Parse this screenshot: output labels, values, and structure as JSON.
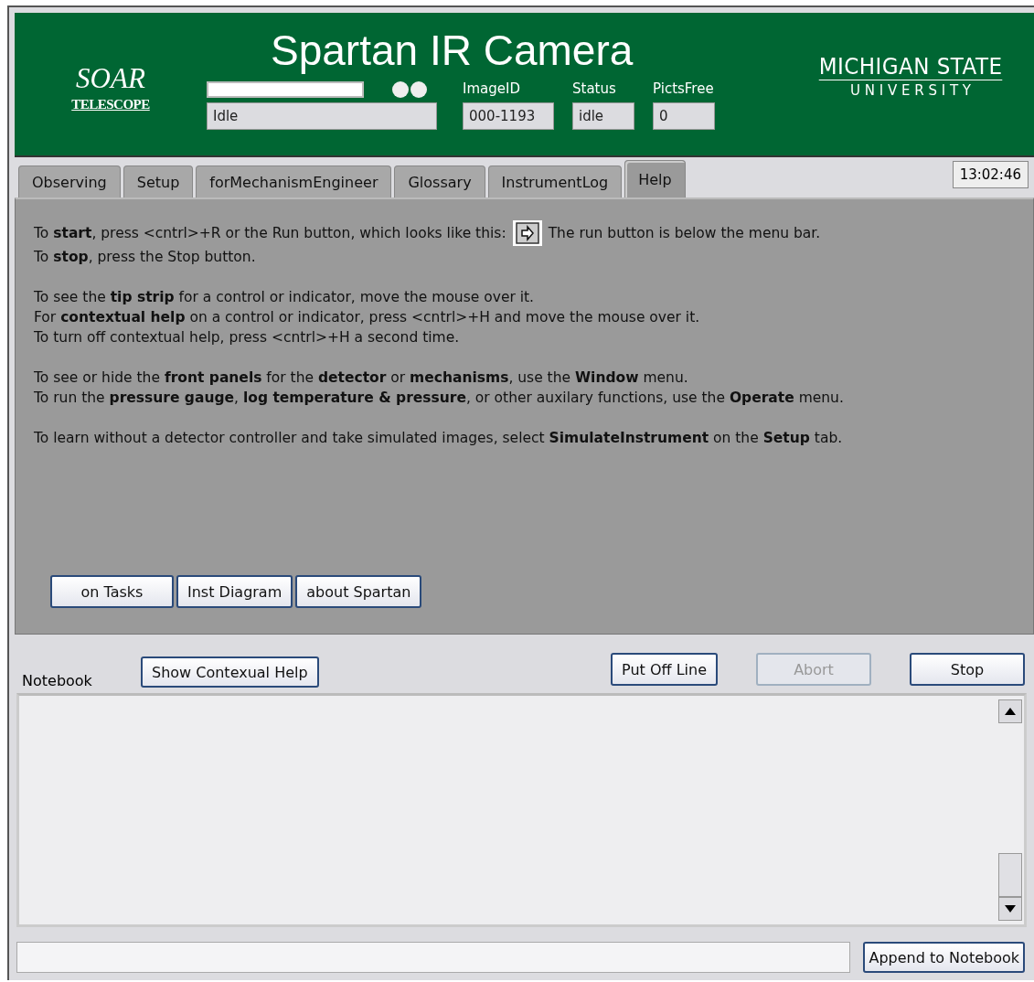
{
  "header": {
    "left_logo": {
      "title": "SOAR",
      "subtitle": "TELESCOPE"
    },
    "title": "Spartan IR Camera",
    "right_logo": {
      "line1": "MICHIGAN STATE",
      "line2": "U N I V E R S I T Y"
    },
    "progress": {
      "level": 1
    },
    "message": {
      "value": "Idle"
    },
    "indicators": [
      {
        "label": "ImageID",
        "value": "000-1193"
      },
      {
        "label": "Status",
        "value": "idle"
      },
      {
        "label": "PictsFree",
        "value": "0"
      }
    ]
  },
  "tabs": [
    {
      "label": "Observing",
      "selected": false
    },
    {
      "label": "Setup",
      "selected": false
    },
    {
      "label": "forMechanismEngineer",
      "selected": false
    },
    {
      "label": "Glossary",
      "selected": false
    },
    {
      "label": "InstrumentLog",
      "selected": false
    },
    {
      "label": "Help",
      "selected": true
    }
  ],
  "clock": "13:02:46",
  "help": {
    "paragraphs": [
      [
        {
          "kind": "with_run_icon",
          "text": "To **start**, press <cntrl>+R or the Run button, which looks like this:",
          "text_after": "The run button is below the menu bar."
        },
        {
          "kind": "plain",
          "text": "To **stop**, press the Stop button."
        }
      ],
      [
        {
          "kind": "plain",
          "text": "To see the **tip strip** for a control or indicator, move the mouse over it."
        },
        {
          "kind": "plain",
          "text": "For **contextual help** on a control or indicator, press <cntrl>+H and move the mouse over it."
        },
        {
          "kind": "plain",
          "text": "To turn off contextual help, press <cntrl>+H a second time."
        }
      ],
      [
        {
          "kind": "plain",
          "text": "To see or hide the **front panels** for the **detector** or **mechanisms**, use the **Window** menu."
        },
        {
          "kind": "plain",
          "text": "To run the **pressure gauge**, **log temperature & pressure**, or other auxilary functions, use the **Operate** menu."
        }
      ],
      [
        {
          "kind": "plain",
          "text": "To learn without a detector controller and take simulated images, select **SimulateInstrument** on the **Setup** tab."
        }
      ]
    ],
    "buttons": [
      {
        "label": "on Tasks"
      },
      {
        "label": "Inst Diagram"
      },
      {
        "label": "about Spartan"
      }
    ]
  },
  "notebook": {
    "label": "Notebook",
    "help_button": {
      "label": "Show Contexual Help"
    },
    "actions": [
      {
        "label": "Put Off Line",
        "disabled": false
      },
      {
        "label": "Abort",
        "disabled": true
      },
      {
        "label": "Stop",
        "disabled": false
      }
    ],
    "append_button": {
      "label": "Append to Notebook"
    }
  }
}
